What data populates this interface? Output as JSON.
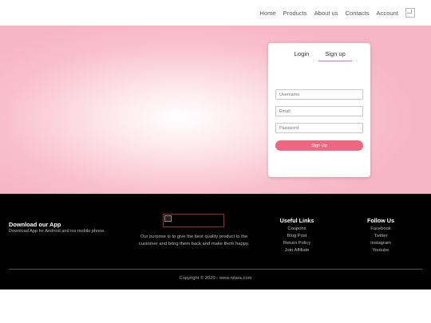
{
  "nav": {
    "items": [
      "Home",
      "Products",
      "About us",
      "Contacts",
      "Account"
    ],
    "cart_icon": "cart-icon"
  },
  "form": {
    "tab_login": "Login",
    "tab_signup": "Sign up",
    "username_placeholder": "Username",
    "email_placeholder": "Email",
    "password_placeholder": "Password",
    "submit_label": "Sign Up"
  },
  "footer": {
    "app_title": "Download our App",
    "app_desc": "Download App for Android and ios mobile phone.",
    "purpose": "Our purpose is to give the best quality product to the customer and bring them back and make them happy.",
    "useful_links": {
      "title": "Useful Links",
      "items": [
        "Coupons",
        "Blog Post",
        "Return Policy",
        "Join Affiliate"
      ]
    },
    "follow_us": {
      "title": "Follow Us",
      "items": [
        "Facebook",
        "Twitter",
        "Instagram",
        "Youtube"
      ]
    },
    "copyright": "Copyright © 2020 - www.nilara.com"
  },
  "colors": {
    "accent": "#ef6682",
    "hero_pink": "#f7b6c5",
    "footer_bg": "#000000"
  }
}
